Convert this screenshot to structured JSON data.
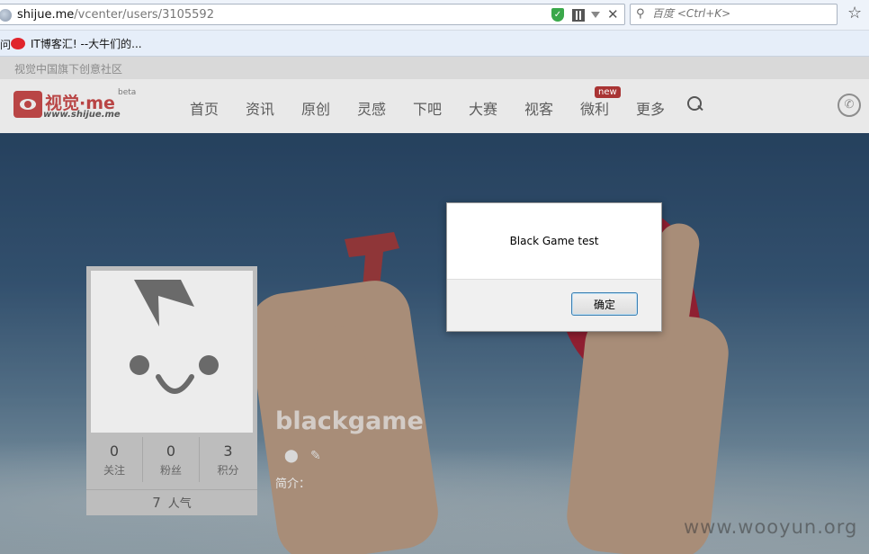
{
  "browser": {
    "url_host": "shijue.me",
    "url_path": "/vcenter/users/3105592",
    "search_placeholder": "百度 <Ctrl+K>",
    "bookmarks": {
      "left_fragment": "问",
      "item": "IT博客汇! --大牛们的..."
    }
  },
  "site": {
    "tagline": "视觉中国旗下创意社区",
    "logo": {
      "name": "视觉·me",
      "beta": "beta",
      "domain": "www.shijue.me"
    },
    "nav": [
      "首页",
      "资讯",
      "原创",
      "灵感",
      "下吧",
      "大赛",
      "视客",
      "微利",
      "更多"
    ],
    "nav_badge": "new"
  },
  "profile": {
    "username": "blackgame",
    "stats": [
      {
        "value": "0",
        "label": "关注"
      },
      {
        "value": "0",
        "label": "粉丝"
      },
      {
        "value": "3",
        "label": "积分"
      }
    ],
    "popularity": {
      "value": "7",
      "label": "人气"
    },
    "intro_label": "简介："
  },
  "dialog": {
    "message": "Black Game test",
    "ok_label": "确定"
  },
  "watermark": "www.wooyun.org",
  "colors": {
    "brand": "#b94545",
    "badge": "#a93434",
    "dialog_button_border": "#3c7fb1"
  }
}
